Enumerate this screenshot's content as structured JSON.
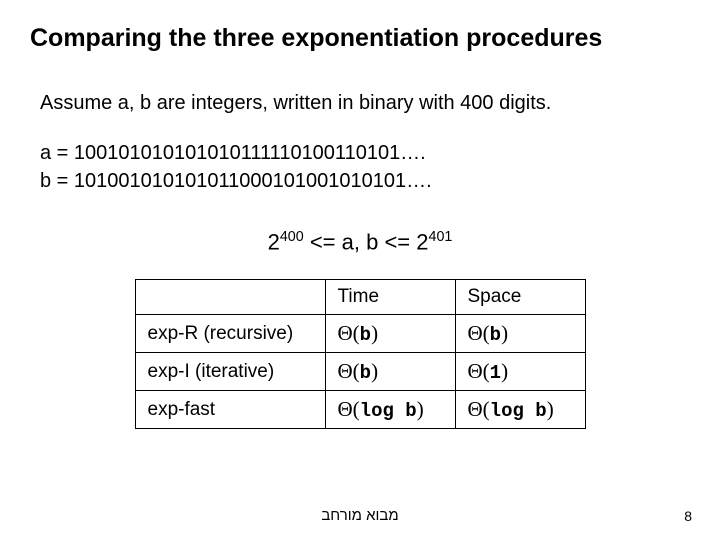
{
  "title": "Comparing the three exponentiation procedures",
  "assume": "Assume a, b are integers, written in binary with 400 digits.",
  "a_line": "a = 100101010101010111110100110101….",
  "b_line": "b = 101001010101011000101001010101….",
  "ineq_base1": "2",
  "ineq_exp1": "400",
  "ineq_mid": "  <=   a, b  <=  ",
  "ineq_base2": "2",
  "ineq_exp2": "401",
  "table": {
    "headers": [
      "",
      "Time",
      "Space"
    ],
    "rows": [
      {
        "label": "exp-R (recursive)",
        "time_pre": "Θ(",
        "time_inner": "b",
        "time_post": ")",
        "space_pre": "Θ(",
        "space_inner": "b",
        "space_post": ")"
      },
      {
        "label": "exp-I (iterative)",
        "time_pre": "Θ(",
        "time_inner": "b",
        "time_post": ")",
        "space_pre": "Θ(",
        "space_inner": "1",
        "space_post": ")"
      },
      {
        "label": "exp-fast",
        "time_pre": "Θ(",
        "time_inner": "log b",
        "time_post": ")",
        "space_pre": "Θ(",
        "space_inner": "log b",
        "space_post": ")"
      }
    ]
  },
  "footer": "מבוא מורחב",
  "page": "8",
  "chart_data": {
    "type": "table",
    "title": "Complexity of exponentiation procedures",
    "categories": [
      "exp-R (recursive)",
      "exp-I (iterative)",
      "exp-fast"
    ],
    "series": [
      {
        "name": "Time",
        "values": [
          "Θ(b)",
          "Θ(b)",
          "Θ(log b)"
        ]
      },
      {
        "name": "Space",
        "values": [
          "Θ(b)",
          "Θ(1)",
          "Θ(log b)"
        ]
      }
    ]
  }
}
